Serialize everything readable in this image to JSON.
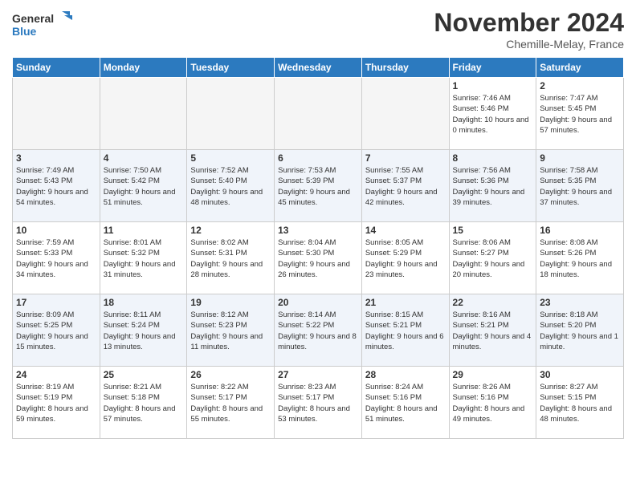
{
  "header": {
    "logo": {
      "line1": "General",
      "line2": "Blue"
    },
    "month": "November 2024",
    "location": "Chemille-Melay, France"
  },
  "days_of_week": [
    "Sunday",
    "Monday",
    "Tuesday",
    "Wednesday",
    "Thursday",
    "Friday",
    "Saturday"
  ],
  "weeks": [
    [
      {
        "day": "",
        "empty": true
      },
      {
        "day": "",
        "empty": true
      },
      {
        "day": "",
        "empty": true
      },
      {
        "day": "",
        "empty": true
      },
      {
        "day": "",
        "empty": true
      },
      {
        "day": "1",
        "sunrise": "7:46 AM",
        "sunset": "5:46 PM",
        "daylight": "10 hours and 0 minutes."
      },
      {
        "day": "2",
        "sunrise": "7:47 AM",
        "sunset": "5:45 PM",
        "daylight": "9 hours and 57 minutes."
      }
    ],
    [
      {
        "day": "3",
        "sunrise": "7:49 AM",
        "sunset": "5:43 PM",
        "daylight": "9 hours and 54 minutes."
      },
      {
        "day": "4",
        "sunrise": "7:50 AM",
        "sunset": "5:42 PM",
        "daylight": "9 hours and 51 minutes."
      },
      {
        "day": "5",
        "sunrise": "7:52 AM",
        "sunset": "5:40 PM",
        "daylight": "9 hours and 48 minutes."
      },
      {
        "day": "6",
        "sunrise": "7:53 AM",
        "sunset": "5:39 PM",
        "daylight": "9 hours and 45 minutes."
      },
      {
        "day": "7",
        "sunrise": "7:55 AM",
        "sunset": "5:37 PM",
        "daylight": "9 hours and 42 minutes."
      },
      {
        "day": "8",
        "sunrise": "7:56 AM",
        "sunset": "5:36 PM",
        "daylight": "9 hours and 39 minutes."
      },
      {
        "day": "9",
        "sunrise": "7:58 AM",
        "sunset": "5:35 PM",
        "daylight": "9 hours and 37 minutes."
      }
    ],
    [
      {
        "day": "10",
        "sunrise": "7:59 AM",
        "sunset": "5:33 PM",
        "daylight": "9 hours and 34 minutes."
      },
      {
        "day": "11",
        "sunrise": "8:01 AM",
        "sunset": "5:32 PM",
        "daylight": "9 hours and 31 minutes."
      },
      {
        "day": "12",
        "sunrise": "8:02 AM",
        "sunset": "5:31 PM",
        "daylight": "9 hours and 28 minutes."
      },
      {
        "day": "13",
        "sunrise": "8:04 AM",
        "sunset": "5:30 PM",
        "daylight": "9 hours and 26 minutes."
      },
      {
        "day": "14",
        "sunrise": "8:05 AM",
        "sunset": "5:29 PM",
        "daylight": "9 hours and 23 minutes."
      },
      {
        "day": "15",
        "sunrise": "8:06 AM",
        "sunset": "5:27 PM",
        "daylight": "9 hours and 20 minutes."
      },
      {
        "day": "16",
        "sunrise": "8:08 AM",
        "sunset": "5:26 PM",
        "daylight": "9 hours and 18 minutes."
      }
    ],
    [
      {
        "day": "17",
        "sunrise": "8:09 AM",
        "sunset": "5:25 PM",
        "daylight": "9 hours and 15 minutes."
      },
      {
        "day": "18",
        "sunrise": "8:11 AM",
        "sunset": "5:24 PM",
        "daylight": "9 hours and 13 minutes."
      },
      {
        "day": "19",
        "sunrise": "8:12 AM",
        "sunset": "5:23 PM",
        "daylight": "9 hours and 11 minutes."
      },
      {
        "day": "20",
        "sunrise": "8:14 AM",
        "sunset": "5:22 PM",
        "daylight": "9 hours and 8 minutes."
      },
      {
        "day": "21",
        "sunrise": "8:15 AM",
        "sunset": "5:21 PM",
        "daylight": "9 hours and 6 minutes."
      },
      {
        "day": "22",
        "sunrise": "8:16 AM",
        "sunset": "5:21 PM",
        "daylight": "9 hours and 4 minutes."
      },
      {
        "day": "23",
        "sunrise": "8:18 AM",
        "sunset": "5:20 PM",
        "daylight": "9 hours and 1 minute."
      }
    ],
    [
      {
        "day": "24",
        "sunrise": "8:19 AM",
        "sunset": "5:19 PM",
        "daylight": "8 hours and 59 minutes."
      },
      {
        "day": "25",
        "sunrise": "8:21 AM",
        "sunset": "5:18 PM",
        "daylight": "8 hours and 57 minutes."
      },
      {
        "day": "26",
        "sunrise": "8:22 AM",
        "sunset": "5:17 PM",
        "daylight": "8 hours and 55 minutes."
      },
      {
        "day": "27",
        "sunrise": "8:23 AM",
        "sunset": "5:17 PM",
        "daylight": "8 hours and 53 minutes."
      },
      {
        "day": "28",
        "sunrise": "8:24 AM",
        "sunset": "5:16 PM",
        "daylight": "8 hours and 51 minutes."
      },
      {
        "day": "29",
        "sunrise": "8:26 AM",
        "sunset": "5:16 PM",
        "daylight": "8 hours and 49 minutes."
      },
      {
        "day": "30",
        "sunrise": "8:27 AM",
        "sunset": "5:15 PM",
        "daylight": "8 hours and 48 minutes."
      }
    ]
  ]
}
